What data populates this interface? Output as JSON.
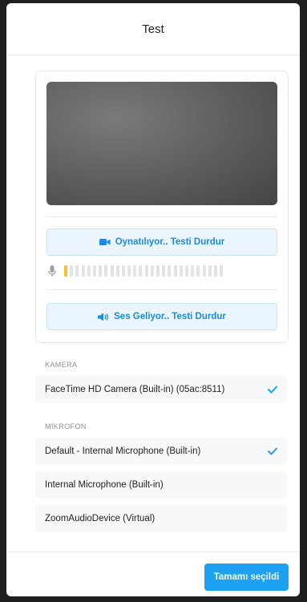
{
  "modal": {
    "title": "Test"
  },
  "test_panel": {
    "camera_button_label": "Oynatılıyor.. Testi Durdur",
    "audio_button_label": "Ses Geliyor.. Testi Durdur",
    "mic_level_active_bars": 1,
    "mic_level_total_bars": 28
  },
  "camera_section": {
    "label": "KAMERA",
    "devices": [
      {
        "name": "FaceTime HD Camera (Built-in) (05ac:8511)",
        "selected": true
      }
    ]
  },
  "microphone_section": {
    "label": "MİKROFON",
    "devices": [
      {
        "name": "Default - Internal Microphone (Built-in)",
        "selected": true
      },
      {
        "name": "Internal Microphone (Built-in)",
        "selected": false
      },
      {
        "name": "ZoomAudioDevice (Virtual)",
        "selected": false
      }
    ]
  },
  "footer": {
    "confirm_label": "Tamamı seçildi"
  },
  "colors": {
    "accent": "#1da1f2",
    "level_active": "#f5c13b",
    "level_inactive": "#e2e4e7"
  },
  "icons": {
    "camera": "video-camera-icon",
    "speaker": "speaker-icon",
    "microphone": "microphone-icon",
    "check": "check-icon"
  }
}
